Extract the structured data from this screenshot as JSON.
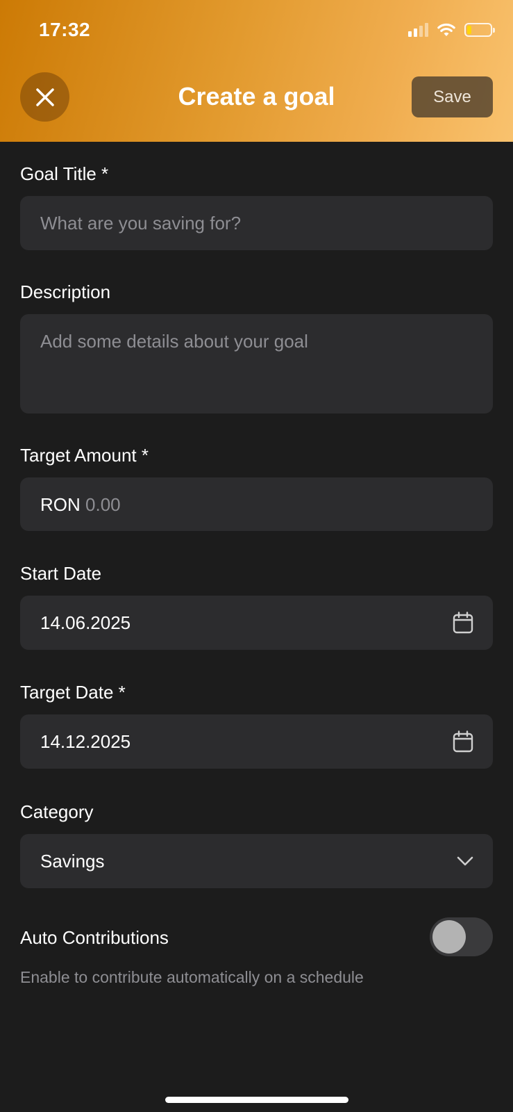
{
  "status_bar": {
    "time": "17:32",
    "signal_icon": "cellular-signal-icon",
    "wifi_icon": "wifi-icon",
    "battery_icon": "battery-low-icon",
    "battery_color": "#ffd60a"
  },
  "header": {
    "title": "Create a goal",
    "close_icon": "close-icon",
    "save_label": "Save",
    "gradient_colors": [
      "#cc7a05",
      "#f9c26e"
    ]
  },
  "form": {
    "goal_title": {
      "label": "Goal Title *",
      "placeholder": "What are you saving for?"
    },
    "description": {
      "label": "Description",
      "placeholder": "Add some details about your goal"
    },
    "target_amount": {
      "label": "Target Amount *",
      "currency": "RON",
      "placeholder": "0.00"
    },
    "start_date": {
      "label": "Start Date",
      "value": "14.06.2025",
      "icon": "calendar-icon"
    },
    "target_date": {
      "label": "Target Date *",
      "value": "14.12.2025",
      "icon": "calendar-icon"
    },
    "category": {
      "label": "Category",
      "value": "Savings",
      "icon": "chevron-down-icon"
    },
    "auto_contributions": {
      "label": "Auto Contributions",
      "enabled": false,
      "helper": "Enable to contribute automatically on a schedule"
    }
  },
  "colors": {
    "background": "#1c1c1c",
    "field": "#2c2c2e",
    "placeholder": "#8e8e93"
  }
}
